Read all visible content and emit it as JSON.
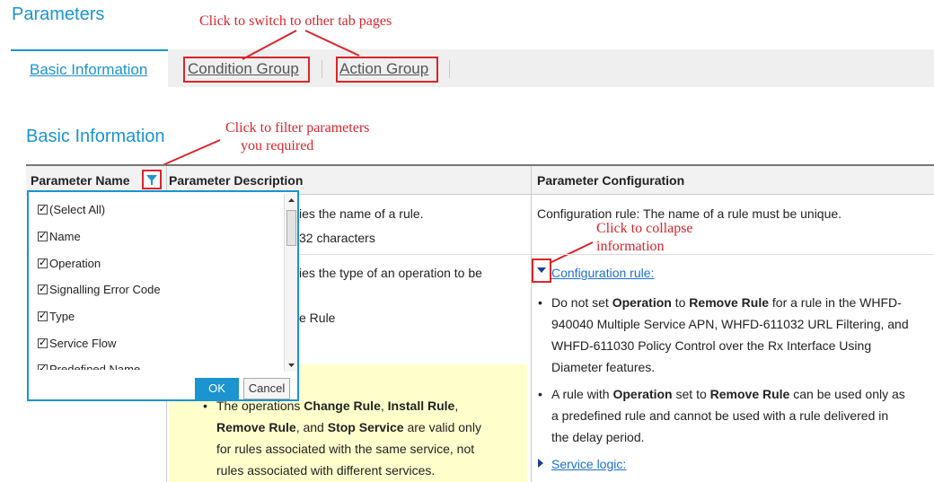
{
  "page": {
    "title": "Parameters"
  },
  "tabs": [
    {
      "label": "Basic Information",
      "active": true
    },
    {
      "label": "Condition Group",
      "active": false
    },
    {
      "label": "Action Group",
      "active": false
    }
  ],
  "annotations": {
    "tabs": "Click to switch to other tab pages",
    "filter_line1": "Click to filter parameters",
    "filter_line2": "you required",
    "collapse_line1": "Click to collapse",
    "collapse_line2": "information"
  },
  "section": {
    "title": "Basic Information"
  },
  "table": {
    "headers": {
      "name": "Parameter Name",
      "description": "Parameter Description",
      "configuration": "Parameter Configuration"
    },
    "row1": {
      "desc_line1": "ies the name of a rule.",
      "desc_line2": "32 characters",
      "config": "Configuration rule: The name of a rule must be unique."
    },
    "row2": {
      "desc_line1": "ies the type of an operation to be",
      "desc_line2": "e Rule",
      "note": {
        "seg1": "The operations ",
        "b1": "Change Rule",
        "seg2": ", ",
        "b2": "Install Rule",
        "seg3": ",",
        "b3": "Remove Rule",
        "seg4": ", and ",
        "b4": "Stop Service",
        "seg5": " are valid only",
        "line3": "for rules associated with the same service, not",
        "line4": "rules associated with different services."
      },
      "config_link": "Configuration rule:",
      "bullet1": {
        "seg1": "Do not set ",
        "b1": "Operation",
        "seg2": " to ",
        "b2": "Remove Rule",
        "seg3": " for a rule in the WHFD-",
        "line2": "940040 Multiple Service APN, WHFD-611032 URL Filtering, and",
        "line3": "WHFD-611030 Policy Control over the Rx Interface Using",
        "line4": "Diameter features."
      },
      "bullet2": {
        "seg1": "A rule with ",
        "b1": "Operation",
        "seg2": " set to ",
        "b2": "Remove Rule",
        "seg3": " can be used only as",
        "line2": "a predefined rule and cannot be used with a rule delivered in",
        "line3": "the delay period."
      },
      "service_link": "Service logic:"
    }
  },
  "filter": {
    "items": [
      {
        "label": "(Select All)",
        "checked": true
      },
      {
        "label": "Name",
        "checked": true
      },
      {
        "label": "Operation",
        "checked": true
      },
      {
        "label": "Signalling Error Code",
        "checked": true
      },
      {
        "label": "Type",
        "checked": true
      },
      {
        "label": "Service Flow",
        "checked": true
      },
      {
        "label": "Predefined Name",
        "checked": true
      }
    ],
    "ok_label": "OK",
    "cancel_label": "Cancel"
  },
  "colors": {
    "accent": "#1b94cf",
    "annotation": "#d9252b",
    "note_bg": "#ffffcc",
    "link": "#1b6fd1"
  }
}
